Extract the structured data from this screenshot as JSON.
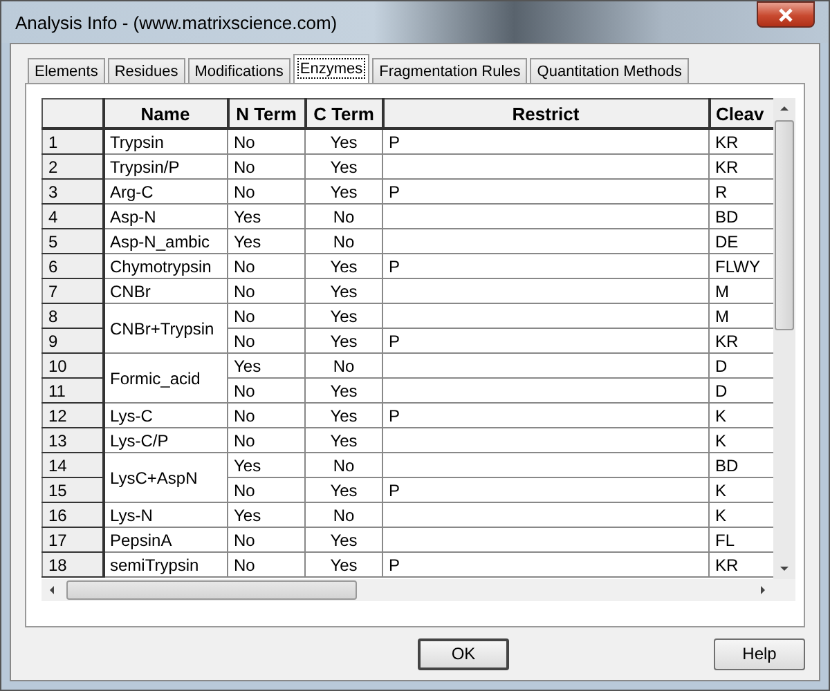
{
  "window": {
    "title": "Analysis Info  - (www.matrixscience.com)"
  },
  "tabs": [
    {
      "label": "Elements",
      "selected": false
    },
    {
      "label": "Residues",
      "selected": false
    },
    {
      "label": "Modifications",
      "selected": false
    },
    {
      "label": "Enzymes",
      "selected": true
    },
    {
      "label": "Fragmentation Rules",
      "selected": false
    },
    {
      "label": "Quantitation Methods",
      "selected": false
    }
  ],
  "table": {
    "columns": [
      "Name",
      "N Term",
      "C Term",
      "Restrict",
      "Cleav"
    ],
    "enzymes": [
      {
        "name": "Trypsin",
        "rows": [
          {
            "index": "1",
            "n_term": "No",
            "c_term": "Yes",
            "restrict": "P",
            "cleave": "KR"
          }
        ]
      },
      {
        "name": "Trypsin/P",
        "rows": [
          {
            "index": "2",
            "n_term": "No",
            "c_term": "Yes",
            "cleave": "KR"
          }
        ]
      },
      {
        "name": "Arg-C",
        "rows": [
          {
            "index": "3",
            "n_term": "No",
            "c_term": "Yes",
            "restrict": "P",
            "cleave": "R"
          }
        ]
      },
      {
        "name": "Asp-N",
        "rows": [
          {
            "index": "4",
            "n_term": "Yes",
            "c_term": "No",
            "cleave": "BD"
          }
        ]
      },
      {
        "name": "Asp-N_ambic",
        "rows": [
          {
            "index": "5",
            "n_term": "Yes",
            "c_term": "No",
            "cleave": "DE"
          }
        ]
      },
      {
        "name": "Chymotrypsin",
        "rows": [
          {
            "index": "6",
            "n_term": "No",
            "c_term": "Yes",
            "restrict": "P",
            "cleave": "FLWY"
          }
        ]
      },
      {
        "name": "CNBr",
        "rows": [
          {
            "index": "7",
            "n_term": "No",
            "c_term": "Yes",
            "cleave": "M"
          }
        ]
      },
      {
        "name": "CNBr+Trypsin",
        "rows": [
          {
            "index": "8",
            "n_term": "No",
            "c_term": "Yes",
            "cleave": "M"
          },
          {
            "index": "9",
            "n_term": "No",
            "c_term": "Yes",
            "restrict": "P",
            "cleave": "KR"
          }
        ]
      },
      {
        "name": "Formic_acid",
        "rows": [
          {
            "index": "10",
            "n_term": "Yes",
            "c_term": "No",
            "cleave": "D"
          },
          {
            "index": "11",
            "n_term": "No",
            "c_term": "Yes",
            "cleave": "D"
          }
        ]
      },
      {
        "name": "Lys-C",
        "rows": [
          {
            "index": "12",
            "n_term": "No",
            "c_term": "Yes",
            "restrict": "P",
            "cleave": "K"
          }
        ]
      },
      {
        "name": "Lys-C/P",
        "rows": [
          {
            "index": "13",
            "n_term": "No",
            "c_term": "Yes",
            "cleave": "K"
          }
        ]
      },
      {
        "name": "LysC+AspN",
        "rows": [
          {
            "index": "14",
            "n_term": "Yes",
            "c_term": "No",
            "cleave": "BD"
          },
          {
            "index": "15",
            "n_term": "No",
            "c_term": "Yes",
            "restrict": "P",
            "cleave": "K"
          }
        ]
      },
      {
        "name": "Lys-N",
        "rows": [
          {
            "index": "16",
            "n_term": "Yes",
            "c_term": "No",
            "cleave": "K"
          }
        ]
      },
      {
        "name": "PepsinA",
        "rows": [
          {
            "index": "17",
            "n_term": "No",
            "c_term": "Yes",
            "cleave": "FL"
          }
        ]
      },
      {
        "name": "semiTrypsin",
        "rows": [
          {
            "index": "18",
            "n_term": "No",
            "c_term": "Yes",
            "restrict": "P",
            "cleave": "KR"
          }
        ]
      }
    ]
  },
  "buttons": [
    "OK",
    "Help"
  ]
}
